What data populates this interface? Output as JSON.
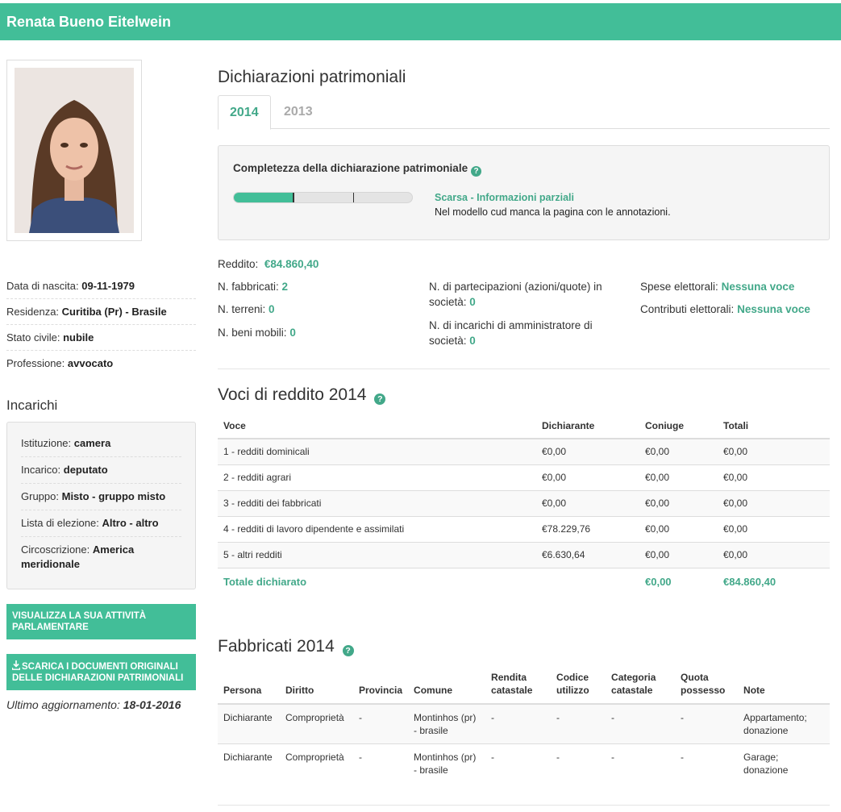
{
  "header": {
    "name": "Renata Bueno Eitelwein"
  },
  "profile": {
    "birth_label": "Data di nascita:",
    "birth_value": "09-11-1979",
    "residence_label": "Residenza:",
    "residence_value": "Curitiba (Pr) - Brasile",
    "civil_label": "Stato civile:",
    "civil_value": "nubile",
    "job_label": "Professione:",
    "job_value": "avvocato"
  },
  "incarichi": {
    "heading": "Incarichi",
    "istituzione_label": "Istituzione:",
    "istituzione_value": "camera",
    "incarico_label": "Incarico:",
    "incarico_value": "deputato",
    "gruppo_label": "Gruppo:",
    "gruppo_value": "Misto - gruppo misto",
    "lista_label": "Lista di elezione:",
    "lista_value": "Altro - altro",
    "circ_label": "Circoscrizione:",
    "circ_value": "America meridionale"
  },
  "buttons": {
    "activity": "VISUALIZZA LA SUA ATTIVITÀ PARLAMENTARE",
    "download": "SCARICA I DOCUMENTI ORIGINALI DELLE DICHIARAZIONI PATRIMONIALI"
  },
  "update": {
    "label": "Ultimo aggiornamento:",
    "value": "18-01-2016"
  },
  "main": {
    "title": "Dichiarazioni patrimoniali",
    "tabs": [
      {
        "label": "2014"
      },
      {
        "label": "2013"
      }
    ]
  },
  "completeness": {
    "title": "Completezza della dichiarazione patrimoniale",
    "help": "?",
    "progress_fraction": 0.34,
    "threshold_fraction": 0.67,
    "level": "Scarsa - Informazioni parziali",
    "note": "Nel modello cud manca la pagina con le annotazioni."
  },
  "summary": {
    "reddito_label": "Reddito:",
    "reddito_value": "€84.860,40",
    "fabbricati_label": "N. fabbricati:",
    "fabbricati_value": "2",
    "terreni_label": "N. terreni:",
    "terreni_value": "0",
    "beni_label": "N. beni mobili:",
    "beni_value": "0",
    "partecipazioni_label": "N. di partecipazioni (azioni/quote) in società:",
    "partecipazioni_value": "0",
    "incarichi_label": "N. di incarichi di amministratore di società:",
    "incarichi_value": "0",
    "spese_label": "Spese elettorali:",
    "spese_value": "Nessuna voce",
    "contributi_label": "Contributi elettorali:",
    "contributi_value": "Nessuna voce"
  },
  "redditi": {
    "title": "Voci di reddito 2014",
    "help": "?",
    "headers": [
      "Voce",
      "Dichiarante",
      "Coniuge",
      "Totali"
    ],
    "rows": [
      [
        "1 - redditi dominicali",
        "€0,00",
        "€0,00",
        "€0,00"
      ],
      [
        "2 - redditi agrari",
        "€0,00",
        "€0,00",
        "€0,00"
      ],
      [
        "3 - redditi dei fabbricati",
        "€0,00",
        "€0,00",
        "€0,00"
      ],
      [
        "4 - redditi di lavoro dipendente e assimilati",
        "€78.229,76",
        "€0,00",
        "€0,00"
      ],
      [
        "5 - altri redditi",
        "€6.630,64",
        "€0,00",
        "€0,00"
      ]
    ],
    "total": [
      "Totale dichiarato",
      "",
      "€0,00",
      "€84.860,40"
    ]
  },
  "fabbricati": {
    "title": "Fabbricati 2014",
    "help": "?",
    "headers": [
      "Persona",
      "Diritto",
      "Provincia",
      "Comune",
      "Rendita catastale",
      "Codice utilizzo",
      "Categoria catastale",
      "Quota possesso",
      "Note"
    ],
    "rows": [
      [
        "Dichiarante",
        "Comproprietà",
        "-",
        "Montinhos (pr) - brasile",
        "-",
        "-",
        "-",
        "-",
        "Appartamento; donazione"
      ],
      [
        "Dichiarante",
        "Comproprietà",
        "-",
        "Montinhos (pr) - brasile",
        "-",
        "-",
        "-",
        "-",
        "Garage; donazione"
      ]
    ]
  }
}
